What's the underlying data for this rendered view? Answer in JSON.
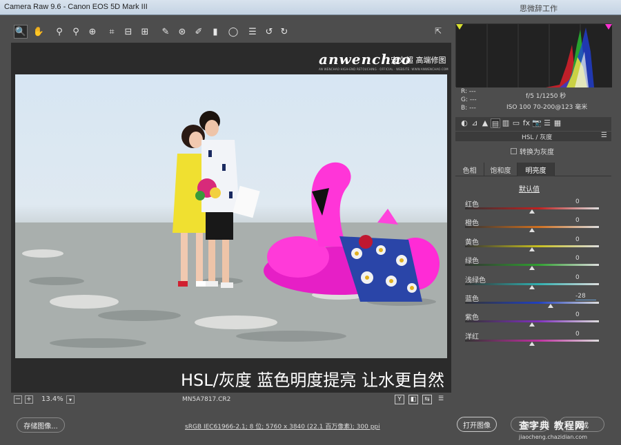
{
  "window": {
    "title": "Camera Raw 9.6 - Canon EOS 5D Mark III",
    "title_right": "思微辞工作"
  },
  "toolbar": {
    "tools": [
      {
        "icon": "zoom-icon",
        "glyph": "🔍",
        "active": true
      },
      {
        "icon": "hand-icon",
        "glyph": "✋"
      },
      {
        "icon": "white-balance-icon",
        "glyph": "⚲"
      },
      {
        "icon": "color-sampler-icon",
        "glyph": "⚲"
      },
      {
        "icon": "targeted-adjustment-icon",
        "glyph": "⊕"
      },
      {
        "icon": "crop-icon",
        "glyph": "⌗"
      },
      {
        "icon": "straighten-icon",
        "glyph": "⊟"
      },
      {
        "icon": "transform-icon",
        "glyph": "⊞"
      },
      {
        "icon": "spot-removal-icon",
        "glyph": "✎"
      },
      {
        "icon": "red-eye-icon",
        "glyph": "⊛"
      },
      {
        "icon": "adjustment-brush-icon",
        "glyph": "✐"
      },
      {
        "icon": "graduated-filter-icon",
        "glyph": "▮"
      },
      {
        "icon": "radial-filter-icon",
        "glyph": "◯"
      },
      {
        "icon": "preferences-icon",
        "glyph": "☰"
      },
      {
        "icon": "rotate-left-icon",
        "glyph": "↺"
      },
      {
        "icon": "rotate-right-icon",
        "glyph": "↻"
      }
    ],
    "fullscreen_icon": "fullscreen-icon",
    "fullscreen_glyph": "⇱"
  },
  "canvas": {
    "logo": {
      "brand": "anwenchao",
      "cn": "安文超 高端修图",
      "sub": "AN WENCHAO HIGH-END RETOUCHING · OFFICIAL · WEBSITE: WWW.ANWENCHAO.COM"
    },
    "caption": "HSL/灰度 蓝色明度提亮 让水更自然"
  },
  "status": {
    "zoom": "13.4%",
    "filename": "MN5A7817.CR2",
    "zoom_out_glyph": "−",
    "zoom_in_glyph": "+",
    "zoom_dropdown_glyph": "▾",
    "view_buttons": [
      "Y",
      "◧",
      "⇆",
      "☰"
    ]
  },
  "bottom": {
    "save_label": "存储图像...",
    "workflow_info": "sRGB IEC61966-2.1; 8 位; 5760 x 3840 (22.1 百万像素); 300 ppi",
    "open_label": "打开图像",
    "cancel_label": "取消",
    "done_label": "完成"
  },
  "readout": {
    "r": "R:  ---",
    "g": "G:  ---",
    "b": "B:  ---",
    "exposure": "f/5   1/1250 秒",
    "iso_lens": "ISO 100   70-200@123 毫米"
  },
  "panel": {
    "tab_icons": [
      "histogram-basic-icon",
      "tone-curve-icon",
      "detail-icon",
      "hsl-icon",
      "split-toning-icon",
      "lens-icon",
      "fx-icon",
      "camera-calibration-icon",
      "presets-icon",
      "snapshots-icon"
    ],
    "tab_glyphs": [
      "◐",
      "⊿",
      "▲",
      "▤",
      "▥",
      "▭",
      "fx",
      "📷",
      "☰",
      "▦"
    ],
    "header": "HSL / 灰度",
    "menu_glyph": "☰",
    "grayscale_label": "转换为灰度",
    "subtabs": [
      "色相",
      "饱和度",
      "明亮度"
    ],
    "active_subtab": 2,
    "default_label": "默认值",
    "sliders": [
      {
        "label": "红色",
        "value": "0",
        "pos": 0.5,
        "color": "#c02020"
      },
      {
        "label": "橙色",
        "value": "0",
        "pos": 0.5,
        "color": "#d07020"
      },
      {
        "label": "黄色",
        "value": "0",
        "pos": 0.5,
        "color": "#c8c020"
      },
      {
        "label": "绿色",
        "value": "0",
        "pos": 0.5,
        "color": "#30a030"
      },
      {
        "label": "浅绿色",
        "value": "0",
        "pos": 0.5,
        "color": "#30b0b0"
      },
      {
        "label": "蓝色",
        "value": "-28",
        "pos": 0.64,
        "color": "#2040c0"
      },
      {
        "label": "紫色",
        "value": "0",
        "pos": 0.5,
        "color": "#8030c0"
      },
      {
        "label": "洋红",
        "value": "0",
        "pos": 0.5,
        "color": "#c030a0"
      }
    ]
  },
  "watermark": {
    "line1": "查字典 教程网",
    "line2": "jiaocheng.chazidian.com"
  }
}
